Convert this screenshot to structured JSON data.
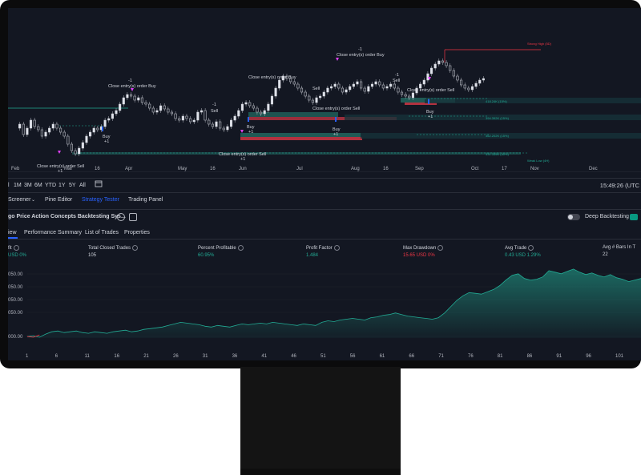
{
  "chart": {
    "months": [
      "Feb",
      "Mar",
      "16",
      "Apr",
      "May",
      "16",
      "Jun",
      "Jul",
      "Aug",
      "16",
      "Sep",
      "Oct",
      "17",
      "Nov",
      "Dec"
    ],
    "annotations": {
      "close_buy_1": "Close entry(s) order Buy",
      "close_sell_1": "Close entry(s) order Sell",
      "close_buy_2": "Close entry(s) order Buy",
      "close_sell_2": "Close entry(s) order Sell",
      "close_sell_3": "Close entry(s) order Sell",
      "close_buy_3": "Close entry(s) order Buy",
      "close_sell_4": "Close entry(s) order Sell",
      "buy": "Buy",
      "sell": "Sell",
      "plus_one": "+1",
      "minus_one": "-1",
      "strong_high": "Strong High (5D)",
      "weak_low": "Weak Low (4H)",
      "lvl1": "418.24K (15%)",
      "lvl2": "394.392K (15%)",
      "lvl3": "362.202K (15%)",
      "lvl4": "331.335K (40%)"
    }
  },
  "timeframes": [
    "1M",
    "3M",
    "6M",
    "YTD",
    "1Y",
    "5Y",
    "All"
  ],
  "clock": "15:49:26 (UTC",
  "panel_tabs": {
    "screener": "Screener",
    "pine": "Pine Editor",
    "tester": "Strategy Tester",
    "trading": "Trading Panel"
  },
  "strategy": {
    "name": "go Price Action Concepts Backtesting Sys...",
    "deep_label": "Deep Backtesting"
  },
  "subtabs": [
    "iew",
    "Performance Summary",
    "List of Trades",
    "Properties"
  ],
  "metrics": [
    {
      "label": "fit",
      "value": "USD  0%",
      "color": "green"
    },
    {
      "label": "Total Closed Trades",
      "value": "105",
      "color": "white"
    },
    {
      "label": "Percent Profitable",
      "value": "60.95%",
      "color": "green"
    },
    {
      "label": "Profit Factor",
      "value": "1.484",
      "color": "green"
    },
    {
      "label": "Max Drawdown",
      "value": "15.65 USD  0%",
      "color": "red"
    },
    {
      "label": "Avg Trade",
      "value": "0.43 USD  1.29%",
      "color": "green"
    },
    {
      "label": "Avg # Bars In T",
      "value": "22",
      "color": "white"
    }
  ],
  "equity": {
    "y_labels": [
      "050.00",
      "050.00",
      "050.00",
      "050.00",
      "000.00"
    ],
    "x_labels": [
      "1",
      "6",
      "11",
      "16",
      "21",
      "26",
      "31",
      "36",
      "41",
      "46",
      "51",
      "56",
      "61",
      "66",
      "71",
      "76",
      "81",
      "86",
      "91",
      "96",
      "101"
    ],
    "values": [
      0,
      1,
      -1,
      3,
      6,
      7,
      5,
      6,
      7,
      5,
      4,
      6,
      5,
      4,
      6,
      7,
      8,
      6,
      7,
      9,
      10,
      11,
      12,
      14,
      16,
      18,
      17,
      16,
      15,
      13,
      12,
      14,
      13,
      12,
      14,
      16,
      15,
      16,
      17,
      16,
      18,
      17,
      16,
      15,
      14,
      16,
      15,
      14,
      18,
      20,
      19,
      21,
      22,
      23,
      22,
      21,
      24,
      25,
      27,
      28,
      30,
      28,
      26,
      25,
      24,
      23,
      22,
      24,
      30,
      38,
      46,
      52,
      56,
      55,
      54,
      57,
      60,
      65,
      72,
      78,
      80,
      74,
      72,
      73,
      76,
      84,
      82,
      80,
      83,
      86,
      82,
      79,
      81,
      78,
      76,
      79,
      75,
      73,
      70,
      72,
      74
    ],
    "accent": "#22ab94"
  }
}
